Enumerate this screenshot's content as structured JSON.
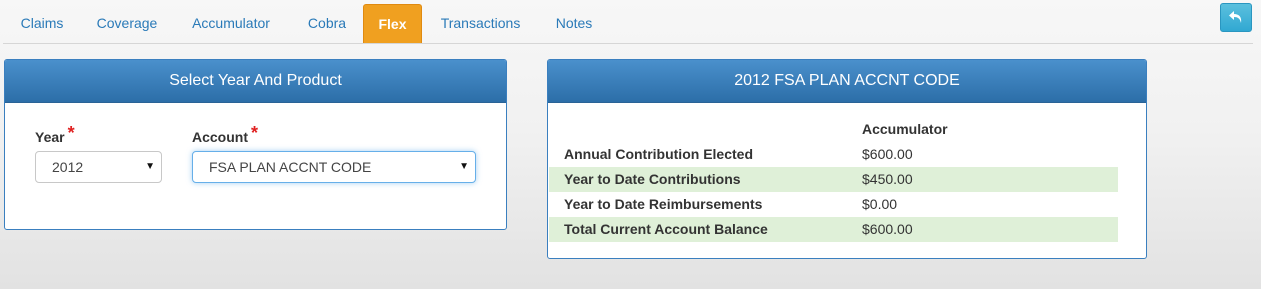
{
  "tabs": [
    {
      "label": "Claims",
      "active": false
    },
    {
      "label": "Coverage",
      "active": false
    },
    {
      "label": "Accumulator",
      "active": false
    },
    {
      "label": "Cobra",
      "active": false
    },
    {
      "label": "Flex",
      "active": true
    },
    {
      "label": "Transactions",
      "active": false
    },
    {
      "label": "Notes",
      "active": false
    }
  ],
  "back_button": {
    "icon": "reply-arrow-icon"
  },
  "select_panel": {
    "title": "Select Year And Product",
    "year_label": "Year",
    "year_value": "2012",
    "account_label": "Account",
    "account_value": "FSA PLAN ACCNT CODE",
    "required_mark": "*"
  },
  "plan_panel": {
    "title": "2012 FSA PLAN ACCNT CODE",
    "column_header": "Accumulator",
    "rows": [
      {
        "label": "Annual Contribution Elected",
        "value": "$600.00"
      },
      {
        "label": "Year to Date Contributions",
        "value": "$450.00"
      },
      {
        "label": "Year to Date Reimbursements",
        "value": "$0.00"
      },
      {
        "label": "Total Current Account Balance",
        "value": "$600.00"
      }
    ]
  },
  "colors": {
    "tab_text": "#2a7ab8",
    "active_tab": "#f0a020",
    "panel_header": "#3a7fbf",
    "row_highlight": "#dff0d8",
    "required": "#e02020"
  }
}
